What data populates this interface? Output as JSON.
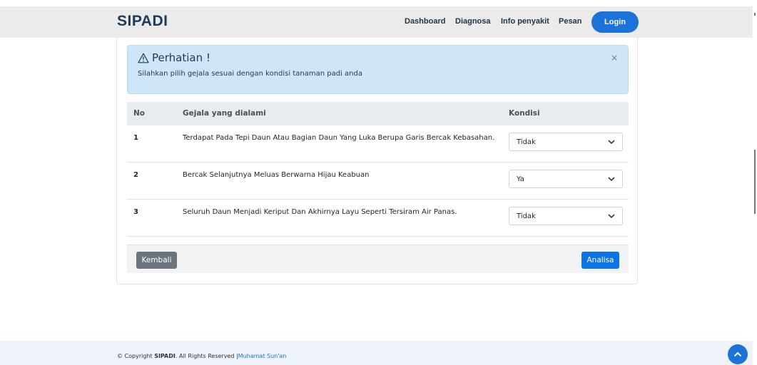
{
  "nav": {
    "brand": "SIPADI",
    "links": [
      "Dashboard",
      "Diagnosa",
      "Info penyakit",
      "Pesan"
    ],
    "login": "Login"
  },
  "alert": {
    "title": "Perhatian !",
    "text": "Silahkan pilih gejala sesuai dengan kondisi tanaman padi anda",
    "close": "×"
  },
  "table": {
    "headers": [
      "No",
      "Gejala yang dialami",
      "Kondisi"
    ],
    "rows": [
      {
        "no": "1",
        "gejala": "Terdapat Pada Tepi Daun Atau Bagian Daun Yang Luka Berupa Garis Bercak Kebasahan.",
        "kondisi": "Tidak"
      },
      {
        "no": "2",
        "gejala": "Bercak Selanjutnya Meluas Berwarna Hijau Keabuan",
        "kondisi": "Ya"
      },
      {
        "no": "3",
        "gejala": "Seluruh Daun Menjadi Keriput Dan Akhirnya Layu Seperti Tersiram Air Panas.",
        "kondisi": "Tidak"
      }
    ]
  },
  "buttons": {
    "back": "Kembali",
    "analyze": "Analisa"
  },
  "footer": {
    "prefix": "© Copyright ",
    "brand": "SIPADI",
    "suffix": ". All Rights Reserved |",
    "author": "Muhamat Sun'an"
  },
  "colors": {
    "primary": "#1b73d9",
    "alert_bg": "#cfe5f8",
    "secondary": "#6c757d"
  }
}
